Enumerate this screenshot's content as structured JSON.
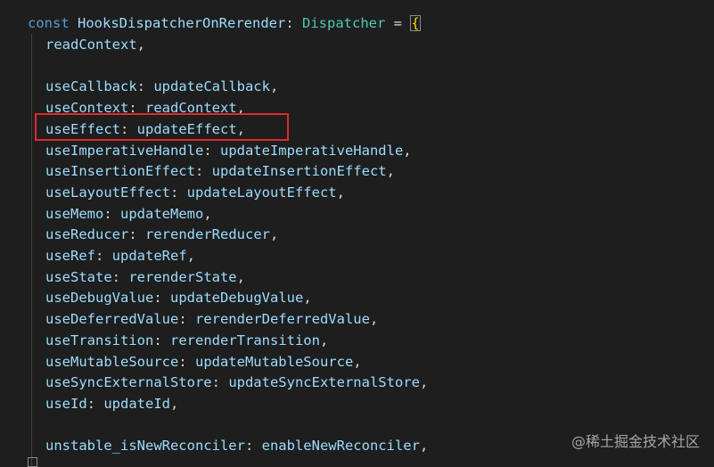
{
  "declaration": {
    "keyword": "const",
    "name": "HooksDispatcherOnRerender",
    "colon": ":",
    "type": "Dispatcher",
    "equals": "=",
    "open_brace": "{"
  },
  "entries": [
    {
      "key": "readContext",
      "value": ""
    },
    {
      "key": "",
      "value": ""
    },
    {
      "key": "useCallback",
      "value": "updateCallback"
    },
    {
      "key": "useContext",
      "value": "readContext"
    },
    {
      "key": "useEffect",
      "value": "updateEffect"
    },
    {
      "key": "useImperativeHandle",
      "value": "updateImperativeHandle"
    },
    {
      "key": "useInsertionEffect",
      "value": "updateInsertionEffect"
    },
    {
      "key": "useLayoutEffect",
      "value": "updateLayoutEffect"
    },
    {
      "key": "useMemo",
      "value": "updateMemo"
    },
    {
      "key": "useReducer",
      "value": "rerenderReducer"
    },
    {
      "key": "useRef",
      "value": "updateRef"
    },
    {
      "key": "useState",
      "value": "rerenderState"
    },
    {
      "key": "useDebugValue",
      "value": "updateDebugValue"
    },
    {
      "key": "useDeferredValue",
      "value": "rerenderDeferredValue"
    },
    {
      "key": "useTransition",
      "value": "rerenderTransition"
    },
    {
      "key": "useMutableSource",
      "value": "updateMutableSource"
    },
    {
      "key": "useSyncExternalStore",
      "value": "updateSyncExternalStore"
    },
    {
      "key": "useId",
      "value": "updateId"
    },
    {
      "key": "",
      "value": ""
    },
    {
      "key": "unstable_isNewReconciler",
      "value": "enableNewReconciler"
    }
  ],
  "highlighted_entry": "useEffect",
  "watermark": "@稀土掘金技术社区",
  "colors": {
    "background": "#1e1e1e",
    "keyword": "#569cd6",
    "type": "#4ec9b0",
    "property": "#9cdcfe",
    "brace": "#ffd700",
    "highlight_border": "#e02a2a"
  }
}
